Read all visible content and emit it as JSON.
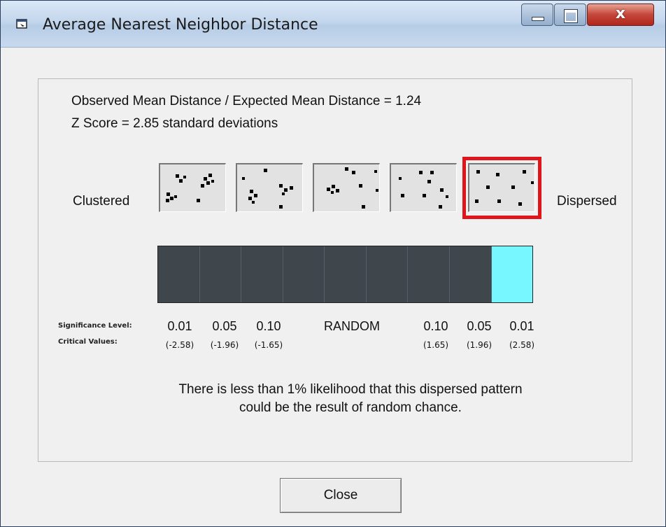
{
  "window": {
    "title": "Average Nearest Neighbor Distance",
    "close_glyph": "x"
  },
  "stats": {
    "ratio_line": "Observed Mean Distance / Expected Mean Distance = 1.24",
    "zscore_line": "Z Score = 2.85 standard deviations"
  },
  "scale": {
    "left_label": "Clustered",
    "right_label": "Dispersed",
    "highlighted_pattern_index": 4,
    "segment_count": 9,
    "active_segment_index": 8,
    "active_color": "#77f7ff",
    "inactive_color": "#3f474c",
    "highlight_color": "#e0141b"
  },
  "significance": {
    "level_header": "Significance Level:",
    "critical_header": "Critical Values:",
    "random_label": "RANDOM",
    "levels": [
      "0.01",
      "0.05",
      "0.10",
      "0.10",
      "0.05",
      "0.01"
    ],
    "critical_values": [
      "(-2.58)",
      "(-1.96)",
      "(-1.65)",
      "(1.65)",
      "(1.96)",
      "(2.58)"
    ]
  },
  "message": {
    "line1": "There is less than 1% likelihood that this dispersed pattern",
    "line2": "could be the result of random chance."
  },
  "buttons": {
    "close_label": "Close"
  }
}
